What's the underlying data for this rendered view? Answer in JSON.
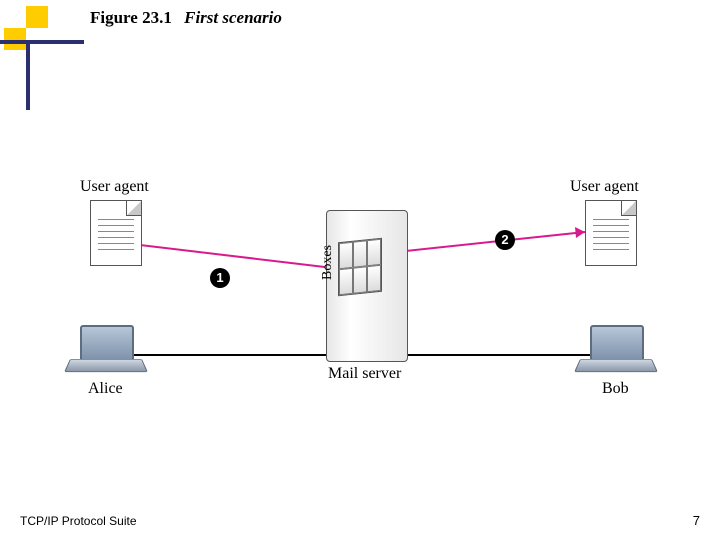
{
  "figure": {
    "number": "Figure 23.1",
    "caption": "First scenario"
  },
  "labels": {
    "user_agent_left": "User agent",
    "user_agent_right": "User agent",
    "alice": "Alice",
    "bob": "Bob",
    "mail_server": "Mail server",
    "boxes": "Boxes"
  },
  "steps": {
    "one": "1",
    "two": "2"
  },
  "footer": {
    "left": "TCP/IP Protocol Suite",
    "page": "7"
  },
  "colors": {
    "accent_yellow": "#ffcc00",
    "accent_navy": "#2c2f6f",
    "arrow_pink": "#d81b8c"
  }
}
